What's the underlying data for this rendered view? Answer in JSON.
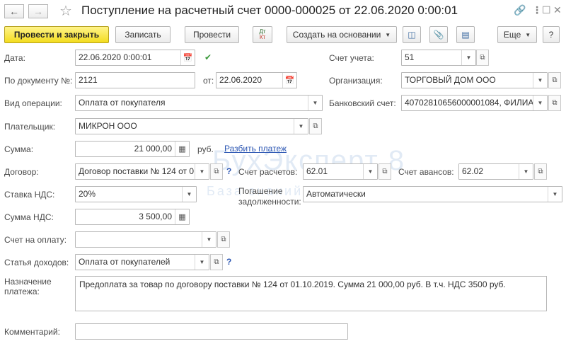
{
  "window": {
    "title": "Поступление на расчетный счет 0000-000025 от 22.06.2020 0:00:01"
  },
  "toolbar": {
    "post_close": "Провести и закрыть",
    "save": "Записать",
    "post": "Провести",
    "dt_kt_top": "Дт",
    "dt_kt_bottom": "Кт",
    "create_based": "Создать на основании",
    "more": "Еще",
    "help": "?"
  },
  "form": {
    "date_label": "Дата:",
    "date_value": "22.06.2020  0:00:01",
    "doc_label": "По документу №:",
    "doc_value": "2121",
    "from_label": "от:",
    "from_value": "22.06.2020",
    "operation_label": "Вид операции:",
    "operation_value": "Оплата от покупателя",
    "payer_label": "Плательщик:",
    "payer_value": "МИКРОН ООО",
    "sum_label": "Сумма:",
    "sum_value": "21 000,00",
    "sum_unit": "руб.",
    "split_link": "Разбить платеж",
    "contract_label": "Договор:",
    "contract_value": "Договор поставки № 124 от 0",
    "vat_rate_label": "Ставка НДС:",
    "vat_rate_value": "20%",
    "vat_sum_label": "Сумма НДС:",
    "vat_sum_value": "3 500,00",
    "invoice_label": "Счет на оплату:",
    "invoice_value": "",
    "income_label": "Статья доходов:",
    "income_value": "Оплата от покупателей",
    "purpose_label_1": "Назначение",
    "purpose_label_2": "платежа:",
    "purpose_value": "Предоплата за товар по договору поставки № 124 от 01.10.2019. Сумма 21 000,00 руб. В т.ч. НДС 3500 руб.",
    "comment_label": "Комментарий:",
    "comment_value": "",
    "account_label": "Счет учета:",
    "account_value": "51",
    "org_label": "Организация:",
    "org_value": "ТОРГОВЫЙ ДОМ ООО",
    "bank_label": "Банковский счет:",
    "bank_value": "40702810656000001084, ФИЛИА",
    "settlement_label": "Счет расчетов:",
    "settlement_value": "62.01",
    "advance_label": "Счет авансов:",
    "advance_value": "62.02",
    "debt_label_1": "Погашение",
    "debt_label_2": "задолженности:",
    "debt_value": "Автоматически",
    "help_q": "?"
  },
  "watermark": {
    "brand": "БухЭксперт 8",
    "tagline": "База знаний по учету в 1С"
  },
  "colors": {
    "primary_button": "#f3dc1f",
    "link": "#2d57b3"
  }
}
